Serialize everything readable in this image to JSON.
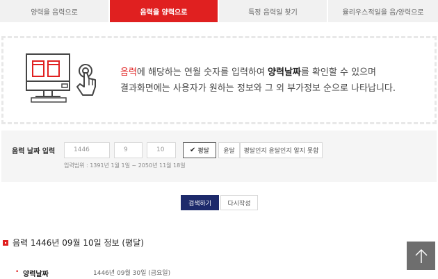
{
  "tabs": [
    {
      "label": "양력을 음력으로",
      "active": false
    },
    {
      "label": "음력을 양력으로",
      "active": true
    },
    {
      "label": "특정 음력일 찾기",
      "active": false
    },
    {
      "label": "율리우스적일을 음/양력으로",
      "active": false
    }
  ],
  "info": {
    "highlight_word": "음력",
    "text_a": "에 해당하는 연월 숫자를 입력하여 ",
    "bold_word": "양력날짜",
    "text_b": "를 확인할 수 있으며",
    "line2": "결과화면에는 사용자가 원하는 정보와 그 외 부가정보 순으로 나타납니다."
  },
  "input": {
    "label": "음력 날짜 입력",
    "year": "1446",
    "month": "9",
    "day": "10",
    "options": [
      "평달",
      "윤달",
      "평달인지 윤달인지 알지 못함"
    ],
    "selected_option": "평달",
    "range_note": "입력범위 : 1391년 1월 1일 ~ 2050년 11월 18일"
  },
  "buttons": {
    "search": "검색하기",
    "reset": "다시작성"
  },
  "result": {
    "heading": "음력 1446년 09월 10일 정보 (평달)",
    "rows": [
      {
        "bullet": "•",
        "label": "양력날짜",
        "value": "1446년 09월 30일 (금요일)"
      }
    ]
  },
  "colors": {
    "accent": "#e02020",
    "navy": "#1d2a6b",
    "top_button": "#6e6e6e"
  },
  "icons": {
    "illustration": "monitor-touch-icon",
    "check": "check-icon",
    "result_marker": "square-bullet-icon",
    "top": "arrow-up-icon"
  }
}
